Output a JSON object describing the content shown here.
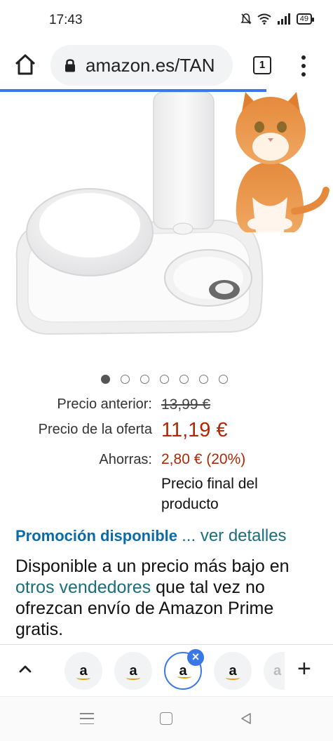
{
  "status_bar": {
    "time": "17:43",
    "battery": "49",
    "icons": [
      "bell-muted-icon",
      "wifi-icon",
      "signal-icon",
      "battery-icon"
    ]
  },
  "toolbar": {
    "url": "amazon.es/TAN",
    "tab_count": "1",
    "icons": [
      "home-icon",
      "lock-icon",
      "tab-switcher-icon",
      "more-vert-icon"
    ]
  },
  "image_carousel": {
    "total": 7,
    "active_index": 0
  },
  "pricing": {
    "previous_label": "Precio anterior:",
    "previous_value": "13,99 €",
    "offer_label": "Precio de la oferta",
    "offer_value": "11,19 €",
    "savings_label": "Ahorras:",
    "savings_value": "2,80 € (20%)",
    "final_note_line1": "Precio final del",
    "final_note_line2": "producto",
    "offer_color": "#b12704"
  },
  "promotion": {
    "title": "Promoción disponible",
    "link": "... ver detalles"
  },
  "availability": {
    "text_before": "Disponible a un precio más bajo en ",
    "link": "otros vendedores",
    "text_after": " que tal vez no ofrezcan envío de Amazon Prime gratis."
  },
  "tab_strip": {
    "tabs": [
      {
        "label": "a",
        "active": false
      },
      {
        "label": "a",
        "active": false
      },
      {
        "label": "a",
        "active": true
      },
      {
        "label": "a",
        "active": false
      },
      {
        "label": "a",
        "active": false
      }
    ],
    "icons": [
      "chevron-up-icon",
      "close-icon",
      "plus-icon"
    ]
  },
  "nav_bar": {
    "icons": [
      "menu-icon",
      "home-square-icon",
      "back-triangle-icon"
    ]
  },
  "colors": {
    "accent": "#3b78e7",
    "link": "#1b6e7b",
    "promo": "#0b6aa8",
    "amazon_orange": "#f29a00"
  }
}
